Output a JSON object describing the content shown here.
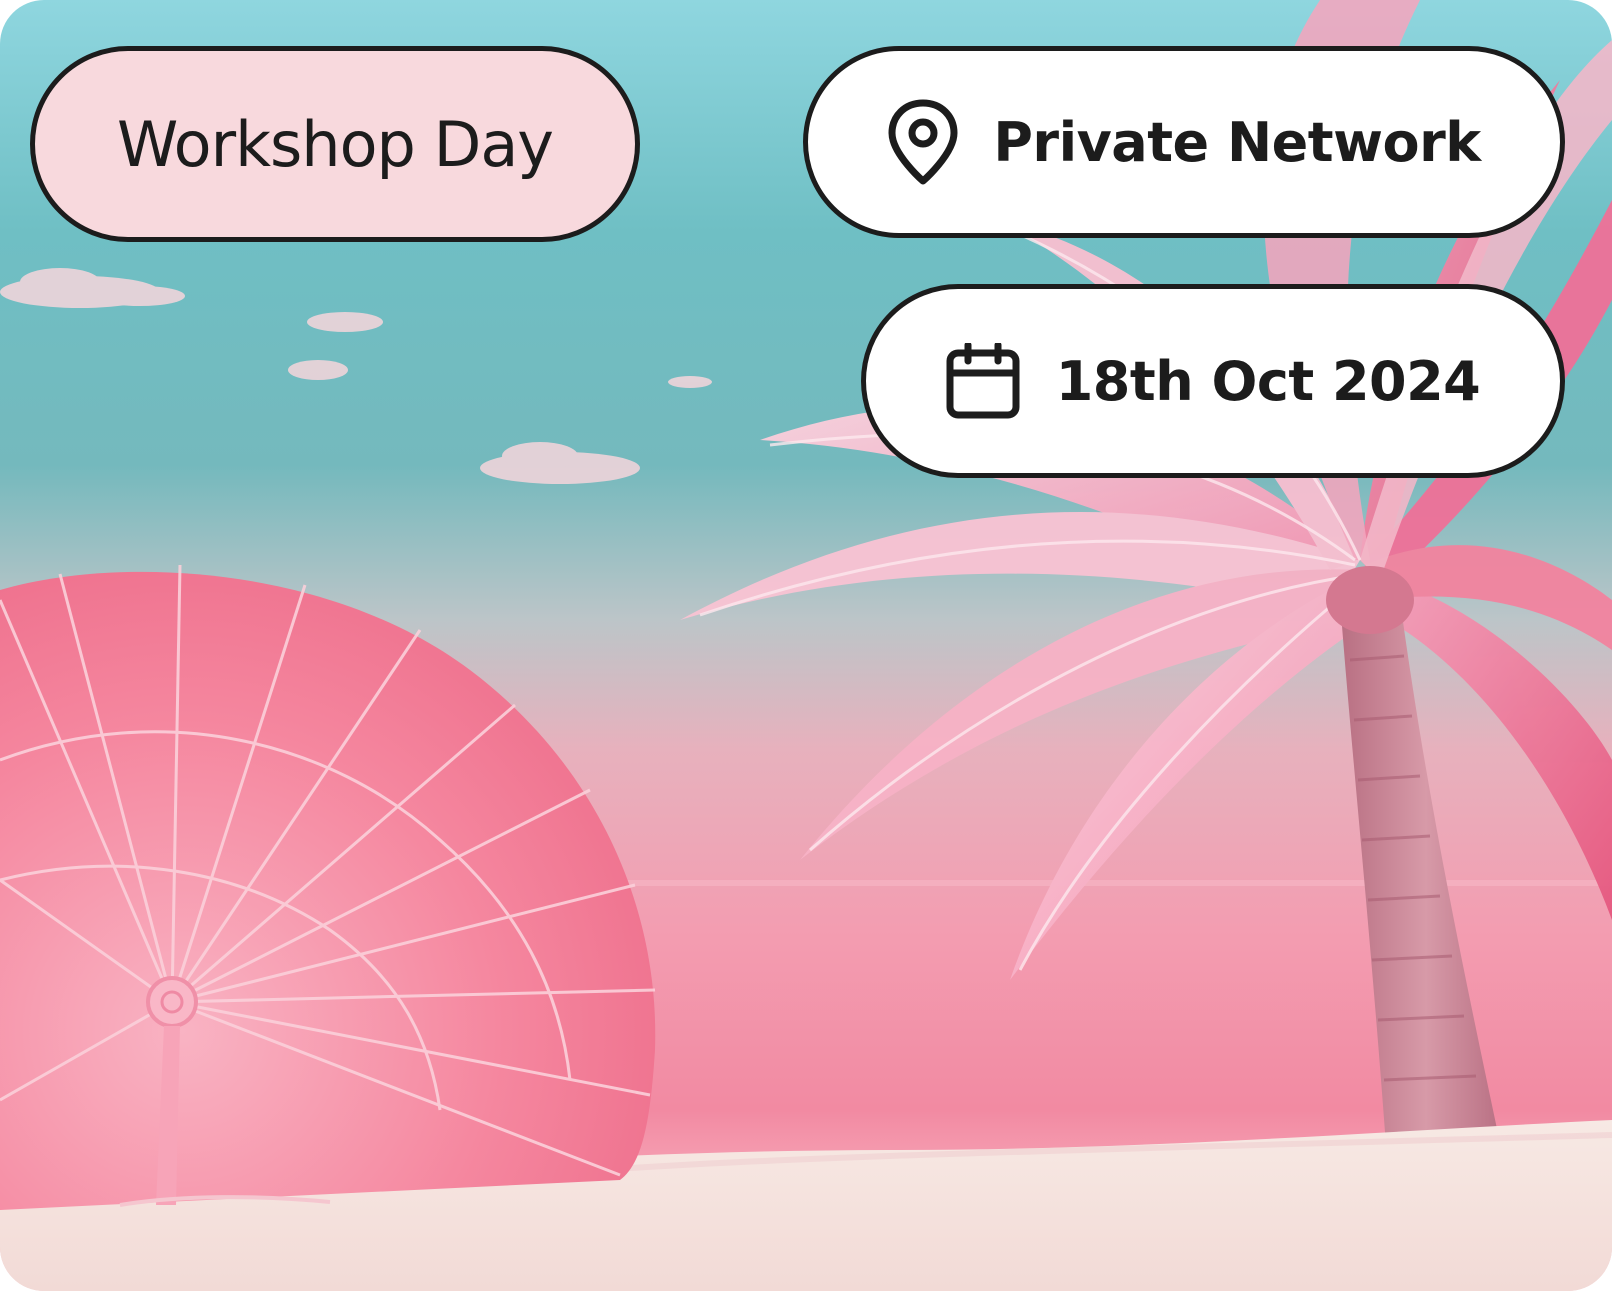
{
  "event": {
    "title": "Workshop Day"
  },
  "location": {
    "icon": "map-pin-icon",
    "label": "Private Network"
  },
  "date": {
    "icon": "calendar-icon",
    "label": "18th Oct 2024"
  },
  "colors": {
    "sky_top": "#8fd6df",
    "sky_mid": "#5fb3b5",
    "pink_haze": "#f3a5b6",
    "sea_pink": "#f28aa2",
    "sand": "#f6e6e3",
    "umbrella_pink": "#f57d99",
    "palm_pink": "#f7a3bd",
    "trunk": "#cf8a9a",
    "event_pill_bg": "#f8d9dd",
    "pill_bg": "#ffffff",
    "outline": "#1c1c1c"
  }
}
